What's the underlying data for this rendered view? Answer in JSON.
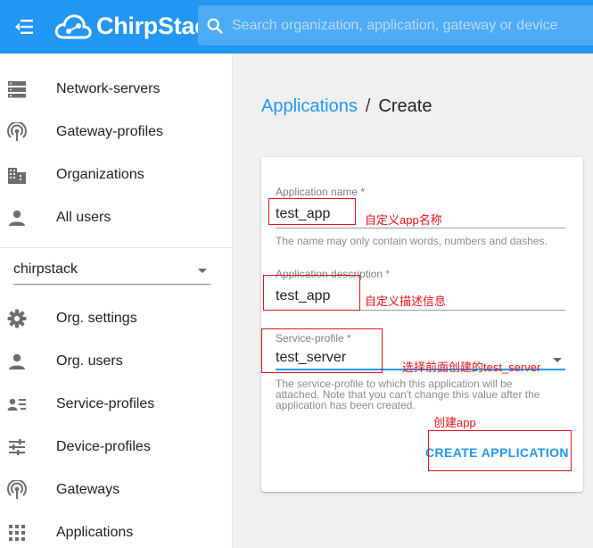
{
  "header": {
    "brand": "ChirpStack",
    "search_placeholder": "Search organization, application, gateway or device"
  },
  "sidebar": {
    "admin_items": [
      {
        "label": "Network-servers",
        "icon": "server-icon"
      },
      {
        "label": "Gateway-profiles",
        "icon": "gateway-signal-icon"
      },
      {
        "label": "Organizations",
        "icon": "building-icon"
      },
      {
        "label": "All users",
        "icon": "person-icon"
      }
    ],
    "org_selector": "chirpstack",
    "org_items": [
      {
        "label": "Org. settings",
        "icon": "gear-icon"
      },
      {
        "label": "Org. users",
        "icon": "person-icon"
      },
      {
        "label": "Service-profiles",
        "icon": "person-list-icon"
      },
      {
        "label": "Device-profiles",
        "icon": "tune-icon"
      },
      {
        "label": "Gateways",
        "icon": "gateway-signal-icon"
      },
      {
        "label": "Applications",
        "icon": "apps-grid-icon"
      }
    ]
  },
  "breadcrumb": {
    "parent": "Applications",
    "separator": "/",
    "current": "Create"
  },
  "form": {
    "name_label": "Application name *",
    "name_value": "test_app",
    "name_help": "The name may only contain words, numbers and dashes.",
    "description_label": "Application description *",
    "description_value": "test_app",
    "service_profile_label": "Service-profile *",
    "service_profile_value": "test_server",
    "service_profile_help_1": "The service-profile to which this application will be",
    "service_profile_help_2": "attached. Note that you can't change this value after the",
    "service_profile_help_3": "application has been created.",
    "submit_label": "CREATE APPLICATION"
  },
  "annotations": {
    "name_note": "自定义app名称",
    "description_note": "自定义描述信息",
    "service_profile_note": "选择前面创建的test_server",
    "create_note": "创建app"
  },
  "colors": {
    "primary": "#2196f3",
    "annotation": "#e0131a"
  }
}
